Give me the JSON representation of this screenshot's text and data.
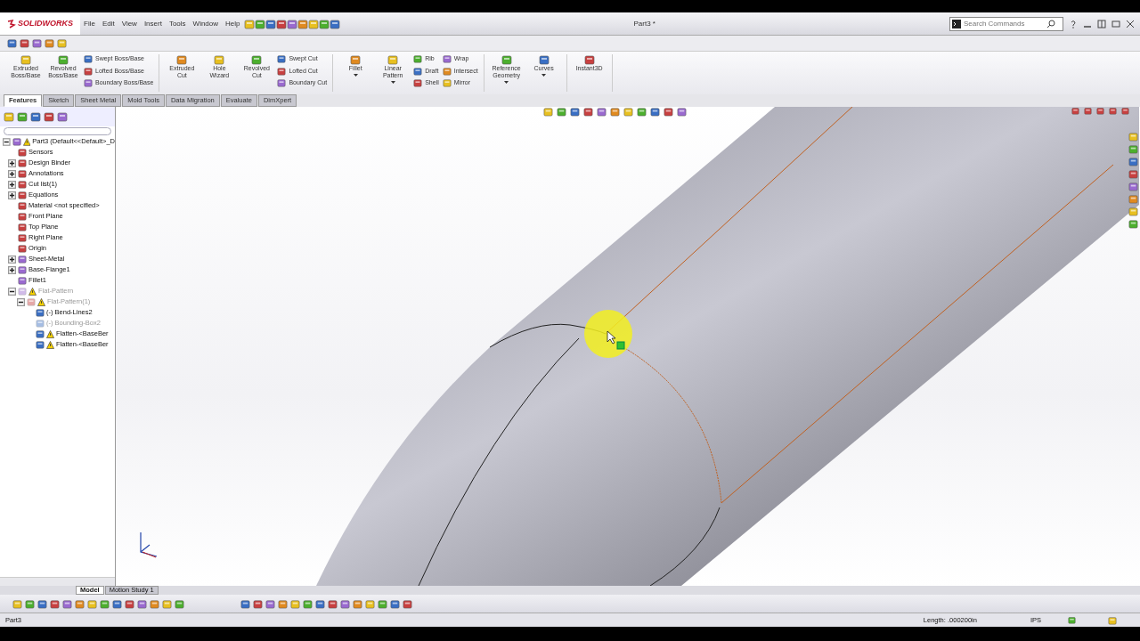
{
  "app": {
    "logo": "SOLIDWORKS",
    "title": "Part3 *"
  },
  "menu": [
    {
      "label": "File"
    },
    {
      "label": "Edit"
    },
    {
      "label": "View"
    },
    {
      "label": "Insert"
    },
    {
      "label": "Tools"
    },
    {
      "label": "Window"
    },
    {
      "label": "Help"
    }
  ],
  "search": {
    "placeholder": "Search Commands"
  },
  "command_groups": [
    [
      {
        "kind": "big",
        "label": "Extruded Boss/Base",
        "dropdown": false
      },
      {
        "kind": "big",
        "label": "Revolved Boss/Base",
        "dropdown": false
      },
      {
        "kind": "stack",
        "items": [
          "Swept Boss/Base",
          "Lofted Boss/Base",
          "Boundary Boss/Base"
        ]
      }
    ],
    [
      {
        "kind": "big",
        "label": "Extruded Cut",
        "dropdown": false
      },
      {
        "kind": "big",
        "label": "Hole Wizard",
        "dropdown": false
      },
      {
        "kind": "big",
        "label": "Revolved Cut",
        "dropdown": false
      },
      {
        "kind": "stack",
        "items": [
          "Swept Cut",
          "Lofted Cut",
          "Boundary Cut"
        ]
      }
    ],
    [
      {
        "kind": "big",
        "label": "Fillet",
        "dropdown": true
      },
      {
        "kind": "big",
        "label": "Linear Pattern",
        "dropdown": true
      },
      {
        "kind": "stack",
        "items": [
          "Rib",
          "Draft",
          "Shell"
        ]
      },
      {
        "kind": "stack",
        "items": [
          "Wrap",
          "Intersect",
          "Mirror"
        ]
      }
    ],
    [
      {
        "kind": "big",
        "label": "Reference Geometry",
        "dropdown": true
      },
      {
        "kind": "big",
        "label": "Curves",
        "dropdown": true
      }
    ],
    [
      {
        "kind": "big",
        "label": "Instant3D",
        "dropdown": false
      }
    ]
  ],
  "tabs": [
    {
      "label": "Features",
      "selected": true
    },
    {
      "label": "Sketch",
      "selected": false
    },
    {
      "label": "Sheet Metal",
      "selected": false
    },
    {
      "label": "Mold Tools",
      "selected": false
    },
    {
      "label": "Data Migration",
      "selected": false
    },
    {
      "label": "Evaluate",
      "selected": false
    },
    {
      "label": "DimXpert",
      "selected": false
    }
  ],
  "tree": {
    "label": "Part3  (Default<<Default>_D",
    "expanded": true,
    "suppressed": false,
    "warning": true,
    "children": [
      {
        "label": "Sensors",
        "suppressed": false,
        "warning": false
      },
      {
        "label": "Design Binder",
        "expanded": false,
        "suppressed": false,
        "warning": false
      },
      {
        "label": "Annotations",
        "expanded": false,
        "suppressed": false,
        "warning": false
      },
      {
        "label": "Cut list(1)",
        "expanded": false,
        "suppressed": false,
        "warning": false
      },
      {
        "label": "Equations",
        "expanded": false,
        "suppressed": false,
        "warning": false
      },
      {
        "label": "Material <not specified>",
        "suppressed": false,
        "warning": false
      },
      {
        "label": "Front Plane",
        "suppressed": false,
        "warning": false
      },
      {
        "label": "Top Plane",
        "suppressed": false,
        "warning": false
      },
      {
        "label": "Right Plane",
        "suppressed": false,
        "warning": false
      },
      {
        "label": "Origin",
        "suppressed": false,
        "warning": false
      },
      {
        "label": "Sheet-Metal",
        "expanded": false,
        "suppressed": false,
        "warning": false
      },
      {
        "label": "Base-Flange1",
        "expanded": false,
        "suppressed": false,
        "warning": false
      },
      {
        "label": "Fillet1",
        "suppressed": false,
        "warning": false
      },
      {
        "label": "Flat-Pattern",
        "expanded": true,
        "suppressed": true,
        "warning": true,
        "children": [
          {
            "label": "Flat-Pattern(1)",
            "expanded": true,
            "suppressed": true,
            "warning": true,
            "children": [
              {
                "label": "(-) Bend-Lines2",
                "suppressed": false,
                "warning": false
              },
              {
                "label": "(-) Bounding-Box2",
                "suppressed": true,
                "warning": false
              },
              {
                "label": "Flatten-<BaseBer",
                "suppressed": false,
                "warning": true
              },
              {
                "label": "Flatten-<BaseBer",
                "suppressed": false,
                "warning": true
              }
            ]
          }
        ]
      }
    ]
  },
  "bottom_tabs": [
    {
      "label": "Model",
      "selected": true
    },
    {
      "label": "Motion Study 1",
      "selected": false
    }
  ],
  "status_bar": {
    "document": "Part3",
    "length": "Length: .000200in",
    "units": "IPS"
  }
}
